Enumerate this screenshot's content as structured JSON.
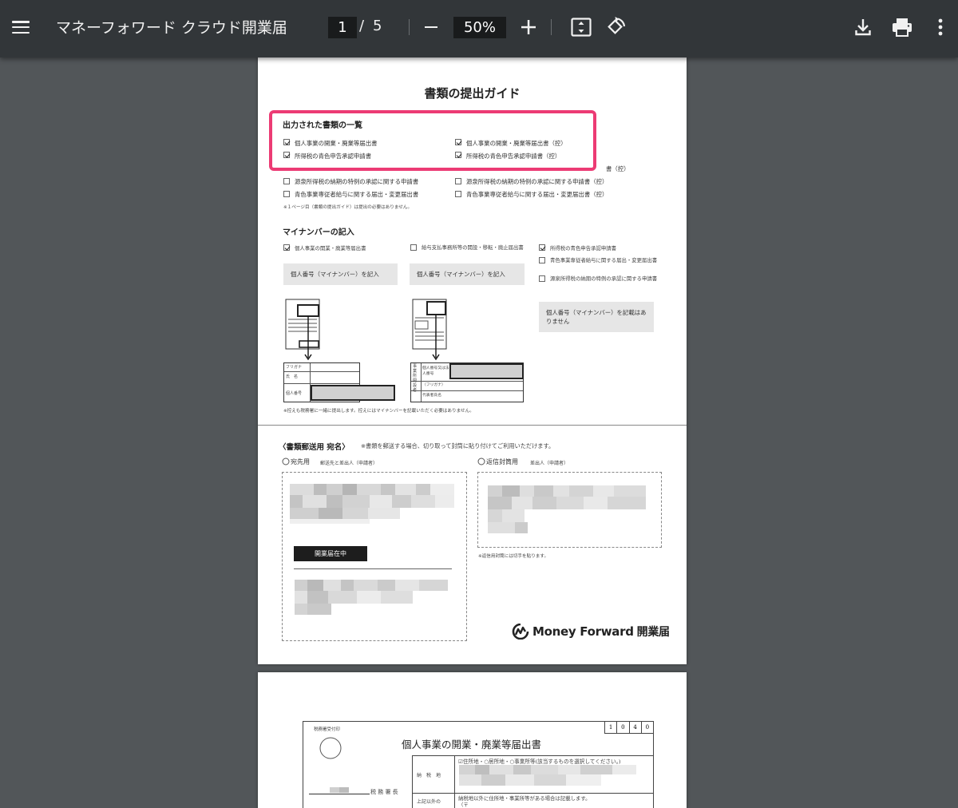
{
  "toolbar": {
    "title": "マネーフォワード クラウド開業届",
    "current_page": "1",
    "page_separator": "/",
    "total_pages": "5",
    "zoom": "50%"
  },
  "page1": {
    "title": "書類の提出ガイド",
    "output_docs": {
      "heading": "出力された書類の一覧",
      "items": [
        {
          "label": "個人事業の開業・廃業等届出書",
          "checked": true
        },
        {
          "label": "個人事業の開業・廃業等届出書（控）",
          "checked": true
        },
        {
          "label": "所得税の青色申告承認申請書",
          "checked": true
        },
        {
          "label": "所得税の青色申告承認申請書（控）",
          "checked": true
        }
      ],
      "partial_label": "書（控）",
      "unchecked_items": [
        {
          "label": "源泉所得税の納期の特例の承認に関する申請書"
        },
        {
          "label": "源泉所得税の納期の特例の承認に関する申請書（控）"
        },
        {
          "label": "青色事業専従者給与に関する届出・変更届出書"
        },
        {
          "label": "青色事業専従者給与に関する届出・変更届出書（控）"
        }
      ],
      "note": "※１ページ目（書類の提出ガイド）は提出の必要はありません。"
    },
    "mynumber": {
      "heading": "マイナンバーの記入",
      "col1": {
        "item": "個人事業の開業・廃業等届出書",
        "box": "個人番号（マイナンバー）を記入"
      },
      "col2": {
        "item": "給与支払事務所等の開設・移転・廃止届出書",
        "box": "個人番号（マイナンバー）を記入"
      },
      "col3": {
        "items": [
          "所得税の青色申告承認申請書",
          "青色事業専従者給与に関する届出・変更届出書",
          "源泉所得税の納期の特例の承認に関する申請書"
        ],
        "box": "個人番号（マイナンバー）を記載はありません"
      },
      "form1_labels": [
        "フリガナ",
        "氏　名",
        "個人番号"
      ],
      "form2_labels": [
        "事業所開設者",
        "個人番号又は法人番号",
        "（フリガナ）",
        "代表者氏名"
      ],
      "note": "※控えも税務署に一緒に提出します。控えにはマイナンバーを記載いただく必要はありません。"
    },
    "mailing": {
      "heading": "〈書類郵送用 宛名〉",
      "heading_note": "※書類を郵送する場合、切り取って封筒に貼り付けてご利用いただけます。",
      "addr_label": "宛先用",
      "addr_sub": "郵送先と差出人（申請者）",
      "return_label": "返信封筒用",
      "return_sub": "差出人（申請者）",
      "stamp": "開業届在中",
      "return_note": "※返信用封筒には切手を貼ります。"
    },
    "logo": {
      "name": "Money Forward",
      "suffix": "開業届"
    }
  },
  "page2": {
    "stamp_label": "税務署受付印",
    "form_title": "個人事業の開業・廃業等届出書",
    "code_digits": [
      "1",
      "0",
      "4",
      "0"
    ],
    "tax_office_suffix": "税 務 署 長",
    "row1_label": "納　税　地",
    "row1_text": "☑住所地・○居所地・○事業所等(該当するものを選択してください。)",
    "row2_label": "上記以外の",
    "row2_text": "納税地以外に住所地・事業所等がある場合は記載します。",
    "row2_sub": "（〒"
  }
}
